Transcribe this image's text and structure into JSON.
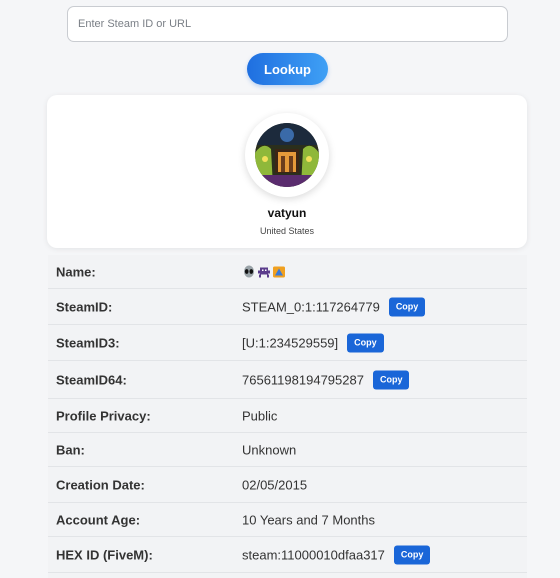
{
  "search": {
    "placeholder": "Enter Steam ID or URL",
    "value": ""
  },
  "lookup_button": "Lookup",
  "profile": {
    "username": "vatyun",
    "country": "United States",
    "name_emoji_icons": [
      "alien-icon",
      "space-invader-icon",
      "card-icon"
    ]
  },
  "copy_label": "Copy",
  "rows": [
    {
      "label": "Name:",
      "value": "",
      "copy": false
    },
    {
      "label": "SteamID:",
      "value": "STEAM_0:1:117264779",
      "copy": true
    },
    {
      "label": "SteamID3:",
      "value": "[U:1:234529559]",
      "copy": true
    },
    {
      "label": "SteamID64:",
      "value": "76561198194795287",
      "copy": true
    },
    {
      "label": "Profile Privacy:",
      "value": "Public",
      "copy": false
    },
    {
      "label": "Ban:",
      "value": "Unknown",
      "copy": false
    },
    {
      "label": "Creation Date:",
      "value": "02/05/2015",
      "copy": false
    },
    {
      "label": "Account Age:",
      "value": "10 Years and 7 Months",
      "copy": false
    },
    {
      "label": "HEX ID (FiveM):",
      "value": "steam:11000010dfaa317",
      "copy": true
    }
  ],
  "colors": {
    "accent": "#1a66d8",
    "lookup_gradient_start": "#1f6fe0",
    "lookup_gradient_end": "#3fa0f5"
  }
}
